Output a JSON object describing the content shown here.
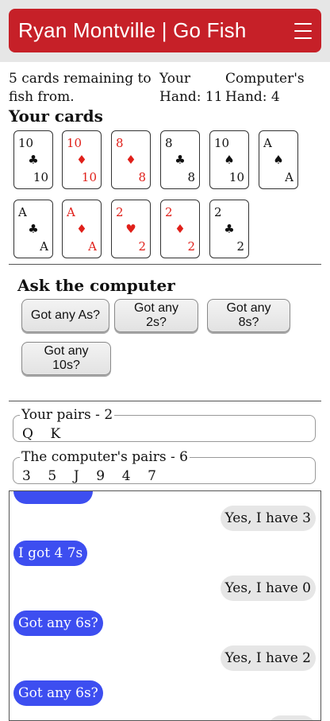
{
  "app": {
    "title": "Ryan Montville | Go Fish",
    "menu_icon": "hamburger-menu-icon"
  },
  "status": {
    "remaining_line1": "5 cards remaining to",
    "remaining_line2": "fish from.",
    "your_hand_line1": "Your",
    "your_hand_line2": "Hand: 11",
    "computer_hand_line1": "Computer's",
    "computer_hand_line2": "Hand: 4"
  },
  "cards_heading": "Your cards",
  "colors": {
    "red_suit": "#e0201a",
    "black_suit": "#111111",
    "app_bar": "#c62028",
    "player_bubble": "#3d4ef0",
    "computer_bubble": "#e6e6e6"
  },
  "hand": [
    {
      "rank": "10",
      "suit": "♣",
      "color": "black"
    },
    {
      "rank": "10",
      "suit": "♦",
      "color": "red"
    },
    {
      "rank": "8",
      "suit": "♦",
      "color": "red"
    },
    {
      "rank": "8",
      "suit": "♣",
      "color": "black"
    },
    {
      "rank": "10",
      "suit": "♠",
      "color": "black"
    },
    {
      "rank": "A",
      "suit": "♠",
      "color": "black"
    },
    {
      "rank": "A",
      "suit": "♣",
      "color": "black"
    },
    {
      "rank": "A",
      "suit": "♦",
      "color": "red"
    },
    {
      "rank": "2",
      "suit": "♥",
      "color": "red"
    },
    {
      "rank": "2",
      "suit": "♦",
      "color": "red"
    },
    {
      "rank": "2",
      "suit": "♣",
      "color": "black"
    }
  ],
  "ask": {
    "heading": "Ask the computer",
    "buttons": [
      "Got any As?",
      "Got any 2s?",
      "Got any 8s?",
      "Got any 10s?"
    ]
  },
  "pairs": {
    "yours_label": "Your pairs - 2",
    "yours_values": "Q    K",
    "computer_label": "The computer's pairs - 6",
    "computer_values": "3    5    J    9    4    7"
  },
  "chat": [
    {
      "from": "me",
      "text": ""
    },
    {
      "from": "them",
      "text": "Yes, I have 3"
    },
    {
      "from": "me",
      "text": "I got 4 7s"
    },
    {
      "from": "them",
      "text": "Yes, I have 0"
    },
    {
      "from": "me",
      "text": "Got any 6s?"
    },
    {
      "from": "them",
      "text": "Yes, I have 2"
    },
    {
      "from": "me",
      "text": "Got any 6s?"
    },
    {
      "from": "them",
      "text": ""
    }
  ]
}
